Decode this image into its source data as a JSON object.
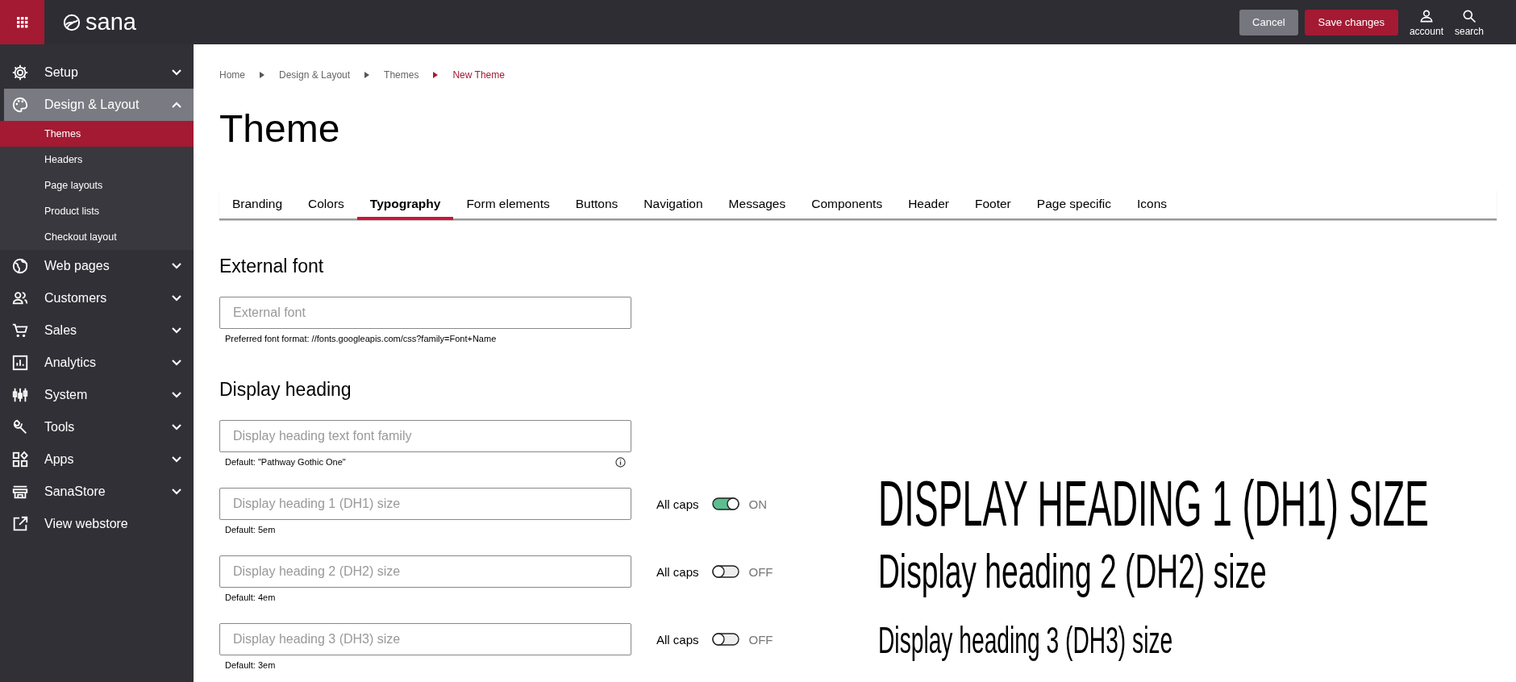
{
  "app": {
    "logo": "sana"
  },
  "topbar": {
    "buttons": [
      {
        "label": "Cancel",
        "kind": "secondary"
      },
      {
        "label": "Save changes",
        "kind": "primary"
      }
    ],
    "actions": [
      {
        "label": "account"
      },
      {
        "label": "search"
      }
    ]
  },
  "sidebar": {
    "items": [
      {
        "label": "Setup",
        "expanded": false,
        "selected": false
      },
      {
        "label": "Design & Layout",
        "expanded": true,
        "selected": true,
        "children": [
          {
            "label": "Themes",
            "selected": true
          },
          {
            "label": "Headers",
            "selected": false
          },
          {
            "label": "Page layouts",
            "selected": false
          },
          {
            "label": "Product lists",
            "selected": false
          },
          {
            "label": "Checkout layout",
            "selected": false
          }
        ]
      },
      {
        "label": "Web pages",
        "expanded": false,
        "selected": false
      },
      {
        "label": "Customers",
        "expanded": false,
        "selected": false
      },
      {
        "label": "Sales",
        "expanded": false,
        "selected": false
      },
      {
        "label": "Analytics",
        "expanded": false,
        "selected": false
      },
      {
        "label": "System",
        "expanded": false,
        "selected": false
      },
      {
        "label": "Tools",
        "expanded": false,
        "selected": false
      },
      {
        "label": "Apps",
        "expanded": false,
        "selected": false
      },
      {
        "label": "SanaStore",
        "expanded": false,
        "selected": false
      },
      {
        "label": "View webstore",
        "selected": false
      }
    ]
  },
  "breadcrumb": [
    {
      "label": "Home",
      "current": false
    },
    {
      "label": "Design & Layout",
      "current": false
    },
    {
      "label": "Themes",
      "current": false
    },
    {
      "label": "New Theme",
      "current": true
    }
  ],
  "title": "Theme",
  "tabs": [
    {
      "label": "Branding",
      "selected": false
    },
    {
      "label": "Colors",
      "selected": false
    },
    {
      "label": "Typography",
      "selected": true
    },
    {
      "label": "Form elements",
      "selected": false
    },
    {
      "label": "Buttons",
      "selected": false
    },
    {
      "label": "Navigation",
      "selected": false
    },
    {
      "label": "Messages",
      "selected": false
    },
    {
      "label": "Components",
      "selected": false
    },
    {
      "label": "Header",
      "selected": false
    },
    {
      "label": "Footer",
      "selected": false
    },
    {
      "label": "Page specific",
      "selected": false
    },
    {
      "label": "Icons",
      "selected": false
    }
  ],
  "sections": [
    {
      "heading": "External font",
      "fields": [
        {
          "placeholder": "External font",
          "help": "Preferred font format: //fonts.googleapis.com/css?family=Font+Name"
        }
      ]
    },
    {
      "heading": "Display heading",
      "fields": [
        {
          "placeholder": "Display heading text font family",
          "help": "Default: \"Pathway Gothic One\"",
          "info": true
        },
        {
          "placeholder": "Display heading 1 (DH1) size",
          "help": "Default: 5em",
          "toggle": {
            "label": "All caps",
            "on": true,
            "state": "ON"
          },
          "preview": {
            "text": "DISPLAY HEADING 1 (DH1) SIZE",
            "kind": "dh1"
          }
        },
        {
          "placeholder": "Display heading 2 (DH2) size",
          "help": "Default: 4em",
          "toggle": {
            "label": "All caps",
            "on": false,
            "state": "OFF"
          },
          "preview": {
            "text": "Display heading 2 (DH2) size",
            "kind": "dh2"
          }
        },
        {
          "placeholder": "Display heading 3 (DH3) size",
          "help": "Default: 3em",
          "toggle": {
            "label": "All caps",
            "on": false,
            "state": "OFF"
          },
          "preview": {
            "text": "Display heading 3 (DH3) size",
            "kind": "dh3"
          }
        }
      ]
    }
  ]
}
